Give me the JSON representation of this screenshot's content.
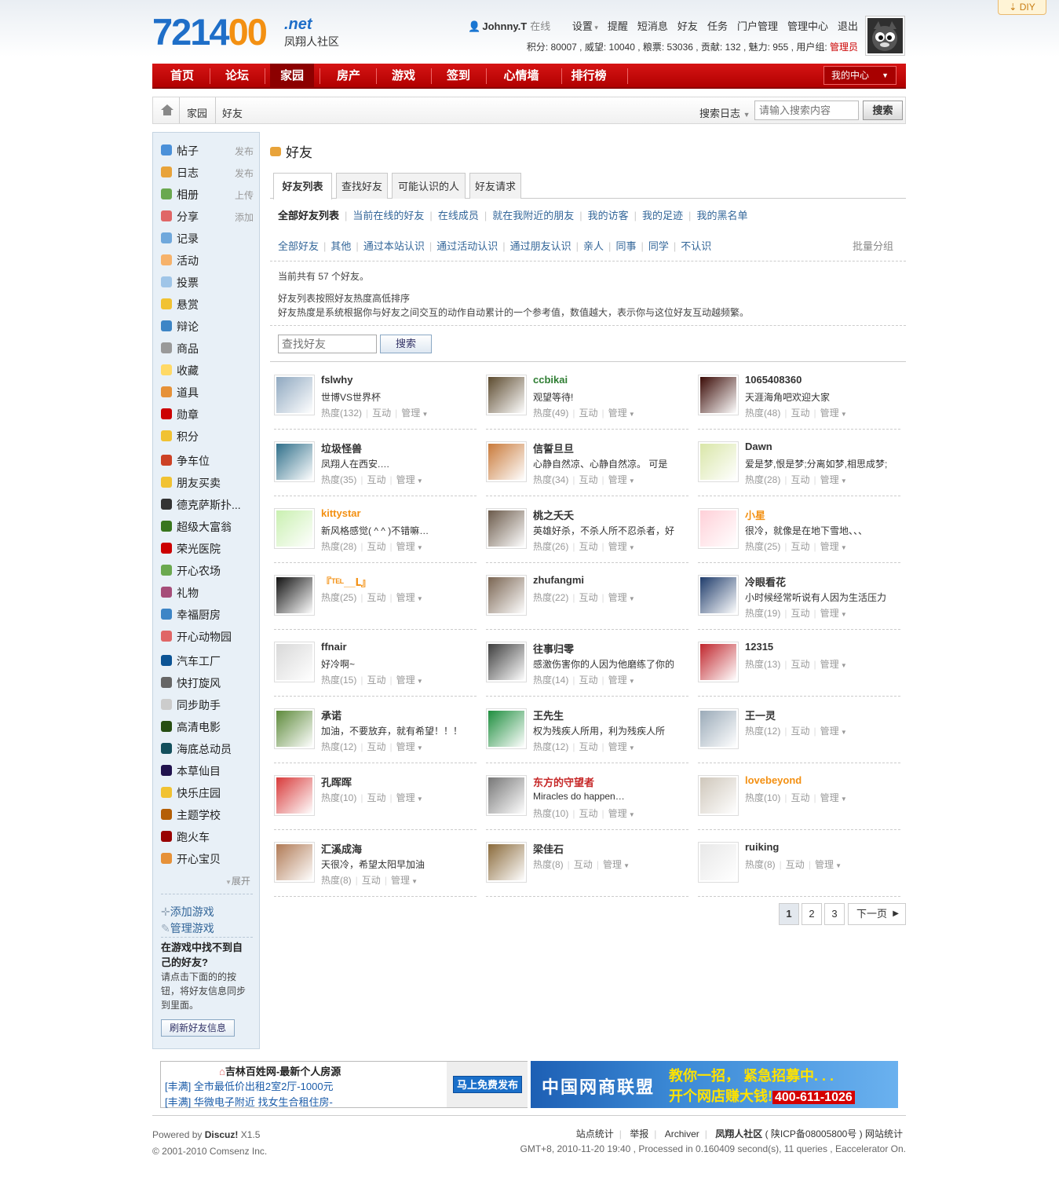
{
  "diy": "DIY",
  "logo": {
    "digits_a": "7214",
    "digits_b": "00",
    ".net": ".net",
    "sub": "凤翔人社区"
  },
  "user": {
    "name": "Johnny.T",
    "status": "在线",
    "links": [
      "设置",
      "提醒",
      "短消息",
      "好友",
      "任务",
      "门户管理",
      "管理中心",
      "退出"
    ],
    "stats": "积分: 80007 , 威望: 10040 , 粮票: 53036 , 贡献: 132 , 魅力: 955 , 用户组: ",
    "group": "管理员"
  },
  "nav": {
    "items": [
      "首页",
      "论坛",
      "家园",
      "房产",
      "游戏",
      "签到",
      "心情墙",
      "排行榜"
    ],
    "current": "家园",
    "my": "我的中心"
  },
  "breadcrumb": {
    "items": [
      "家园",
      "好友"
    ],
    "search_label": "搜索日志",
    "search_placeholder": "请输入搜索内容",
    "search_btn": "搜索"
  },
  "sidebar": {
    "apps": [
      {
        "label": "帖子",
        "action": "发布",
        "color": "#4a90d9"
      },
      {
        "label": "日志",
        "action": "发布",
        "color": "#e8a33a"
      },
      {
        "label": "相册",
        "action": "上传",
        "color": "#6aa84f"
      },
      {
        "label": "分享",
        "action": "添加",
        "color": "#e06666"
      },
      {
        "label": "记录",
        "action": "",
        "color": "#6fa8dc"
      },
      {
        "label": "活动",
        "action": "",
        "color": "#f6b26b"
      },
      {
        "label": "投票",
        "action": "",
        "color": "#9fc5e8"
      },
      {
        "label": "悬赏",
        "action": "",
        "color": "#f1c232"
      },
      {
        "label": "辩论",
        "action": "",
        "color": "#3d85c6"
      },
      {
        "label": "商品",
        "action": "",
        "color": "#999999"
      },
      {
        "label": "收藏",
        "action": "",
        "color": "#ffd966"
      },
      {
        "label": "道具",
        "action": "",
        "color": "#e69138"
      },
      {
        "label": "勋章",
        "action": "",
        "color": "#cc0000"
      },
      {
        "label": "积分",
        "action": "",
        "color": "#f1c232"
      }
    ],
    "games": [
      {
        "label": "争车位",
        "color": "#cc4125"
      },
      {
        "label": "朋友买卖",
        "color": "#f1c232"
      },
      {
        "label": "德克萨斯扑...",
        "color": "#333333"
      },
      {
        "label": "超级大富翁",
        "color": "#38761d"
      },
      {
        "label": "荣光医院",
        "color": "#cc0000"
      },
      {
        "label": "开心农场",
        "color": "#6aa84f"
      },
      {
        "label": "礼物",
        "color": "#a64d79"
      },
      {
        "label": "幸福厨房",
        "color": "#3d85c6"
      },
      {
        "label": "开心动物园",
        "color": "#e06666"
      },
      {
        "label": "汽车工厂",
        "color": "#0b5394"
      },
      {
        "label": "快打旋风",
        "color": "#666666"
      },
      {
        "label": "同步助手",
        "color": "#cccccc"
      },
      {
        "label": "高清电影",
        "color": "#274e13"
      },
      {
        "label": "海底总动员",
        "color": "#134f5c"
      },
      {
        "label": "本草仙目",
        "color": "#20124d"
      },
      {
        "label": "快乐庄园",
        "color": "#f1c232"
      },
      {
        "label": "主题学校",
        "color": "#b45f06"
      },
      {
        "label": "跑火车",
        "color": "#990000"
      },
      {
        "label": "开心宝贝",
        "color": "#e69138"
      }
    ],
    "more": "展开",
    "add_game": "添加游戏",
    "manage_game": "管理游戏",
    "tip_title": "在游戏中找不到自己的好友?",
    "tip_body": "请点击下面的的按钮，将好友信息同步到里面。",
    "refresh": "刷新好友信息"
  },
  "main": {
    "title": "好友",
    "tabs": [
      "好友列表",
      "查找好友",
      "可能认识的人",
      "好友请求"
    ],
    "sub1": [
      "全部好友列表",
      "当前在线的好友",
      "在线成员",
      "就在我附近的朋友",
      "我的访客",
      "我的足迹",
      "我的黑名单"
    ],
    "sub2": [
      "全部好友",
      "其他",
      "通过本站认识",
      "通过活动认识",
      "通过朋友认识",
      "亲人",
      "同事",
      "同学",
      "不认识"
    ],
    "batch": "批量分组",
    "count": "当前共有 57 个好友。",
    "desc1": "好友列表按照好友热度高低排序",
    "desc2": "好友热度是系统根据你与好友之间交互的动作自动累计的一个参考值，数值越大，表示你与这位好友互动越频繁。",
    "find_placeholder": "查找好友",
    "find_btn": "搜索",
    "interact": "互动",
    "manage": "管理",
    "friends": [
      {
        "name": "fslwhy",
        "status": "世博VS世界杯",
        "heat": "热度(132)",
        "nc": "#333",
        "av": "#8fa8c0"
      },
      {
        "name": "ccbikai",
        "status": "观望等待!",
        "heat": "热度(49)",
        "nc": "#2e7d32",
        "av": "#5c4a2e"
      },
      {
        "name": "1065408360",
        "status": "天涯海角吧欢迎大家",
        "heat": "热度(48)",
        "nc": "#333",
        "av": "#3a0a05"
      },
      {
        "name": "垃圾怪兽",
        "status": "凤翔人在西安.…",
        "heat": "热度(35)",
        "nc": "#333",
        "av": "#2f6f8a"
      },
      {
        "name": "信誓旦旦",
        "status": "心静自然凉、心静自然凉。 可是",
        "heat": "热度(34)",
        "nc": "#333",
        "av": "#c97a3a"
      },
      {
        "name": "Dawn",
        "status": "爱是梦,恨是梦;分离如梦,相思成梦;",
        "heat": "热度(28)",
        "nc": "#333",
        "av": "#d9e6a8"
      },
      {
        "name": "kittystar",
        "status": "新风格感觉( ^ ^ )不错嘛…",
        "heat": "热度(28)",
        "nc": "#f39012",
        "av": "#c9f0b0"
      },
      {
        "name": "桃之夭夭",
        "status": "英雄好杀，不杀人所不忍杀者，好",
        "heat": "热度(26)",
        "nc": "#333",
        "av": "#6b5a4a"
      },
      {
        "name": "小星",
        "status": "很冷，就像是在地下雪地、、、",
        "heat": "热度(25)",
        "nc": "#f39012",
        "av": "#ffd0d8"
      },
      {
        "name": "『ᵀᴱᴸ__Լ』",
        "status": "",
        "heat": "热度(25)",
        "nc": "#f39012",
        "av": "#111111"
      },
      {
        "name": "zhufangmi",
        "status": "",
        "heat": "热度(22)",
        "nc": "#333",
        "av": "#7a6552"
      },
      {
        "name": "冷眼看花",
        "status": "小时候经常听说有人因为生活压力",
        "heat": "热度(19)",
        "nc": "#333",
        "av": "#1f3c6b"
      },
      {
        "name": "ffnair",
        "status": "好冷啊~",
        "heat": "热度(15)",
        "nc": "#333",
        "av": "#d8d8d8"
      },
      {
        "name": "往事归零",
        "status": "感激伤害你的人因为他磨练了你的",
        "heat": "热度(14)",
        "nc": "#333",
        "av": "#3d3d3d"
      },
      {
        "name": "12315",
        "status": "",
        "heat": "热度(13)",
        "nc": "#333",
        "av": "#c0262d"
      },
      {
        "name": "承诺",
        "status": "加油，不要放弃，就有希望！！！",
        "heat": "热度(12)",
        "nc": "#333",
        "av": "#5d8a3a"
      },
      {
        "name": "王先生",
        "status": "权为残疾人所用，利为残疾人所",
        "heat": "热度(12)",
        "nc": "#333",
        "av": "#1e8e3e"
      },
      {
        "name": "王一灵",
        "status": "",
        "heat": "热度(12)",
        "nc": "#333",
        "av": "#9aaab8"
      },
      {
        "name": "孔晖晖",
        "status": "",
        "heat": "热度(10)",
        "nc": "#333",
        "av": "#d83a3a"
      },
      {
        "name": "东方的守望者",
        "status": "Miracles do happen…",
        "heat": "热度(10)",
        "nc": "#c62828",
        "av": "#777777"
      },
      {
        "name": "lovebeyond",
        "status": "",
        "heat": "热度(10)",
        "nc": "#f39012",
        "av": "#cfc7bb"
      },
      {
        "name": "汇溪成海",
        "status": "天很冷，希望太阳早加油",
        "heat": "热度(8)",
        "nc": "#333",
        "av": "#b07a55"
      },
      {
        "name": "梁佳石",
        "status": "",
        "heat": "热度(8)",
        "nc": "#333",
        "av": "#8a6a3a"
      },
      {
        "name": "ruiking",
        "status": "",
        "heat": "热度(8)",
        "nc": "#333",
        "av": "#e8e8e8"
      }
    ],
    "pager": [
      "1",
      "2",
      "3"
    ],
    "next": "下一页"
  },
  "ads": {
    "a_title": "吉林百姓网-最新个人房源",
    "a_l1": "[丰满] 全市最低价出租2室2厅-1000元",
    "a_l2": "[丰满] 华微电子附近  找女生合租住房-",
    "a_btn": "马上免费发布",
    "b_a": "中国网商联盟",
    "b_b": "教你一招，  紧急招募中. . .",
    "b_c1": "开个网店赚大钱!",
    "b_c2": "400-611-1026"
  },
  "footer": {
    "powered_prefix": "Powered by ",
    "powered_brand": "Discuz!",
    "powered_ver": " X1.5",
    "copy": "© 2001-2010 Comsenz Inc.",
    "links": [
      "站点统计",
      "举报",
      "Archiver"
    ],
    "site": "凤翔人社区",
    "icp": "( 陕ICP备08005800号 )",
    "stat": "网站统计",
    "gmt": "GMT+8, 2010-11-20 19:40 , Processed in 0.160409 second(s), 11 queries , Eaccelerator On."
  }
}
